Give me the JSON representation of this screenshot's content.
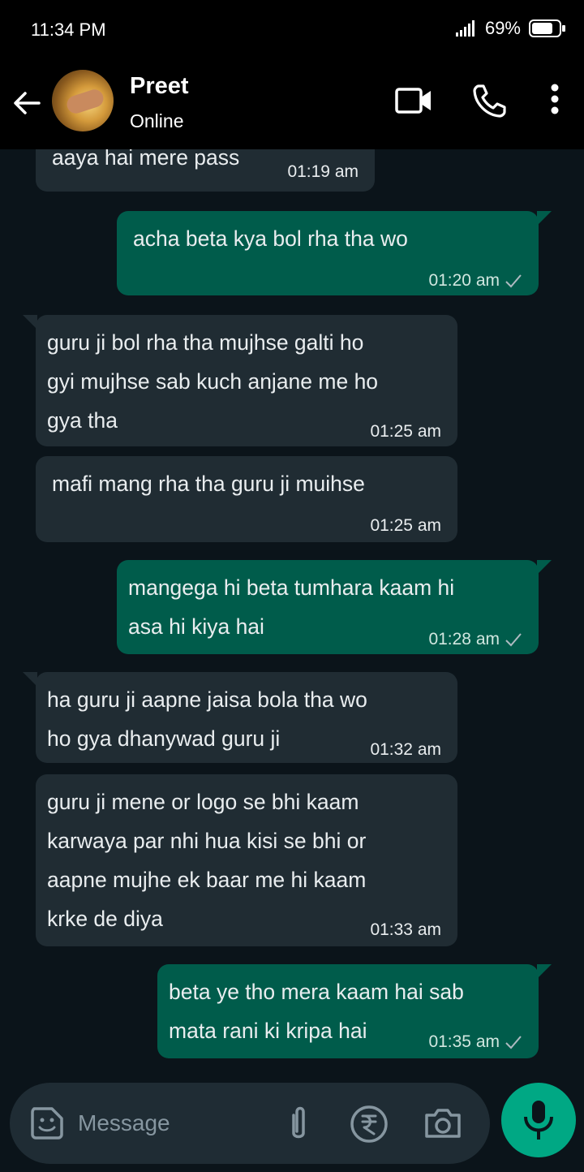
{
  "status": {
    "time": "11:34 PM",
    "battery": "69%"
  },
  "header": {
    "contact_name": "Preet",
    "presence": "Online"
  },
  "messages": [
    {
      "dir": "in",
      "text": "aaya hai mere pass",
      "time": "01:19 am"
    },
    {
      "dir": "out",
      "text": "acha beta kya bol rha tha wo",
      "time": "01:20 am"
    },
    {
      "dir": "in",
      "text": "guru ji bol rha tha mujhse galti ho\ngyi mujhse sab kuch anjane me ho\ngya tha",
      "time": "01:25 am"
    },
    {
      "dir": "in",
      "text": "mafi mang rha tha guru ji muihse",
      "time": "01:25 am"
    },
    {
      "dir": "out",
      "text": "mangega hi beta tumhara kaam hi\nasa hi kiya hai",
      "time": "01:28 am"
    },
    {
      "dir": "in",
      "text": "ha guru ji aapne jaisa bola tha wo\nho gya dhanywad guru ji",
      "time": "01:32 am"
    },
    {
      "dir": "in",
      "text": "guru ji mene or logo se bhi kaam\nkarwaya par nhi hua kisi se bhi or\naapne mujhe ek baar me hi kaam\nkrke de diya",
      "time": "01:33 am"
    },
    {
      "dir": "out",
      "text": "beta ye tho mera kaam hai sab\nmata rani ki kripa hai",
      "time": "01:35 am"
    }
  ],
  "input": {
    "placeholder": "Message"
  },
  "icons": {
    "back": "arrow-left-icon",
    "video": "video-call-icon",
    "call": "phone-icon",
    "more": "more-vertical-icon",
    "sticker": "sticker-icon",
    "attach": "paperclip-icon",
    "payment": "rupee-icon",
    "camera": "camera-icon",
    "mic": "microphone-icon",
    "read": "check-icon",
    "signal": "signal-icon",
    "battery_icon": "battery-icon"
  },
  "colors": {
    "background": "#0b141a",
    "incoming": "#202c33",
    "outgoing": "#005c4b",
    "accent": "#00a884"
  }
}
